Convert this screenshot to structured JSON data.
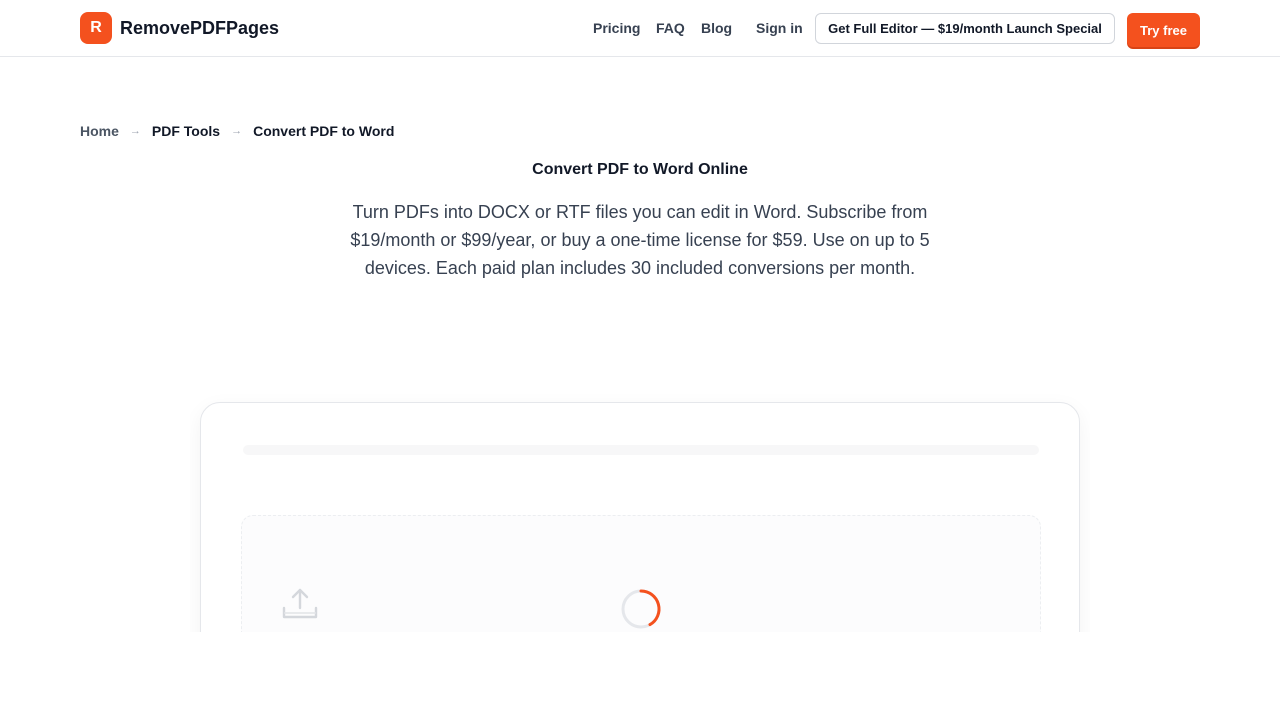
{
  "header": {
    "logo_letter": "R",
    "brand": "RemovePDFPages",
    "nav": [
      "Pricing",
      "FAQ",
      "Blog"
    ],
    "sign_in": "Sign in",
    "editor_cta": "Get Full Editor — $19/month Launch Special",
    "try_free": "Try free"
  },
  "breadcrumb": {
    "items": [
      "Home",
      "PDF Tools",
      "Convert PDF to Word"
    ],
    "separator": "→"
  },
  "main": {
    "title": "Convert PDF to Word Online",
    "description": "Turn PDFs into DOCX or RTF files you can edit in Word. Subscribe from $19/month or $99/year, or buy a one-time license for $59. Use on up to 5 devices. Each paid plan includes 30 included conversions per month."
  },
  "tool": {
    "upload_icon": "upload-icon",
    "spinner_icon": "loading-spinner-icon"
  },
  "colors": {
    "accent": "#f4511e",
    "text": "#111827",
    "muted": "#374151",
    "border": "#e5e7eb"
  }
}
